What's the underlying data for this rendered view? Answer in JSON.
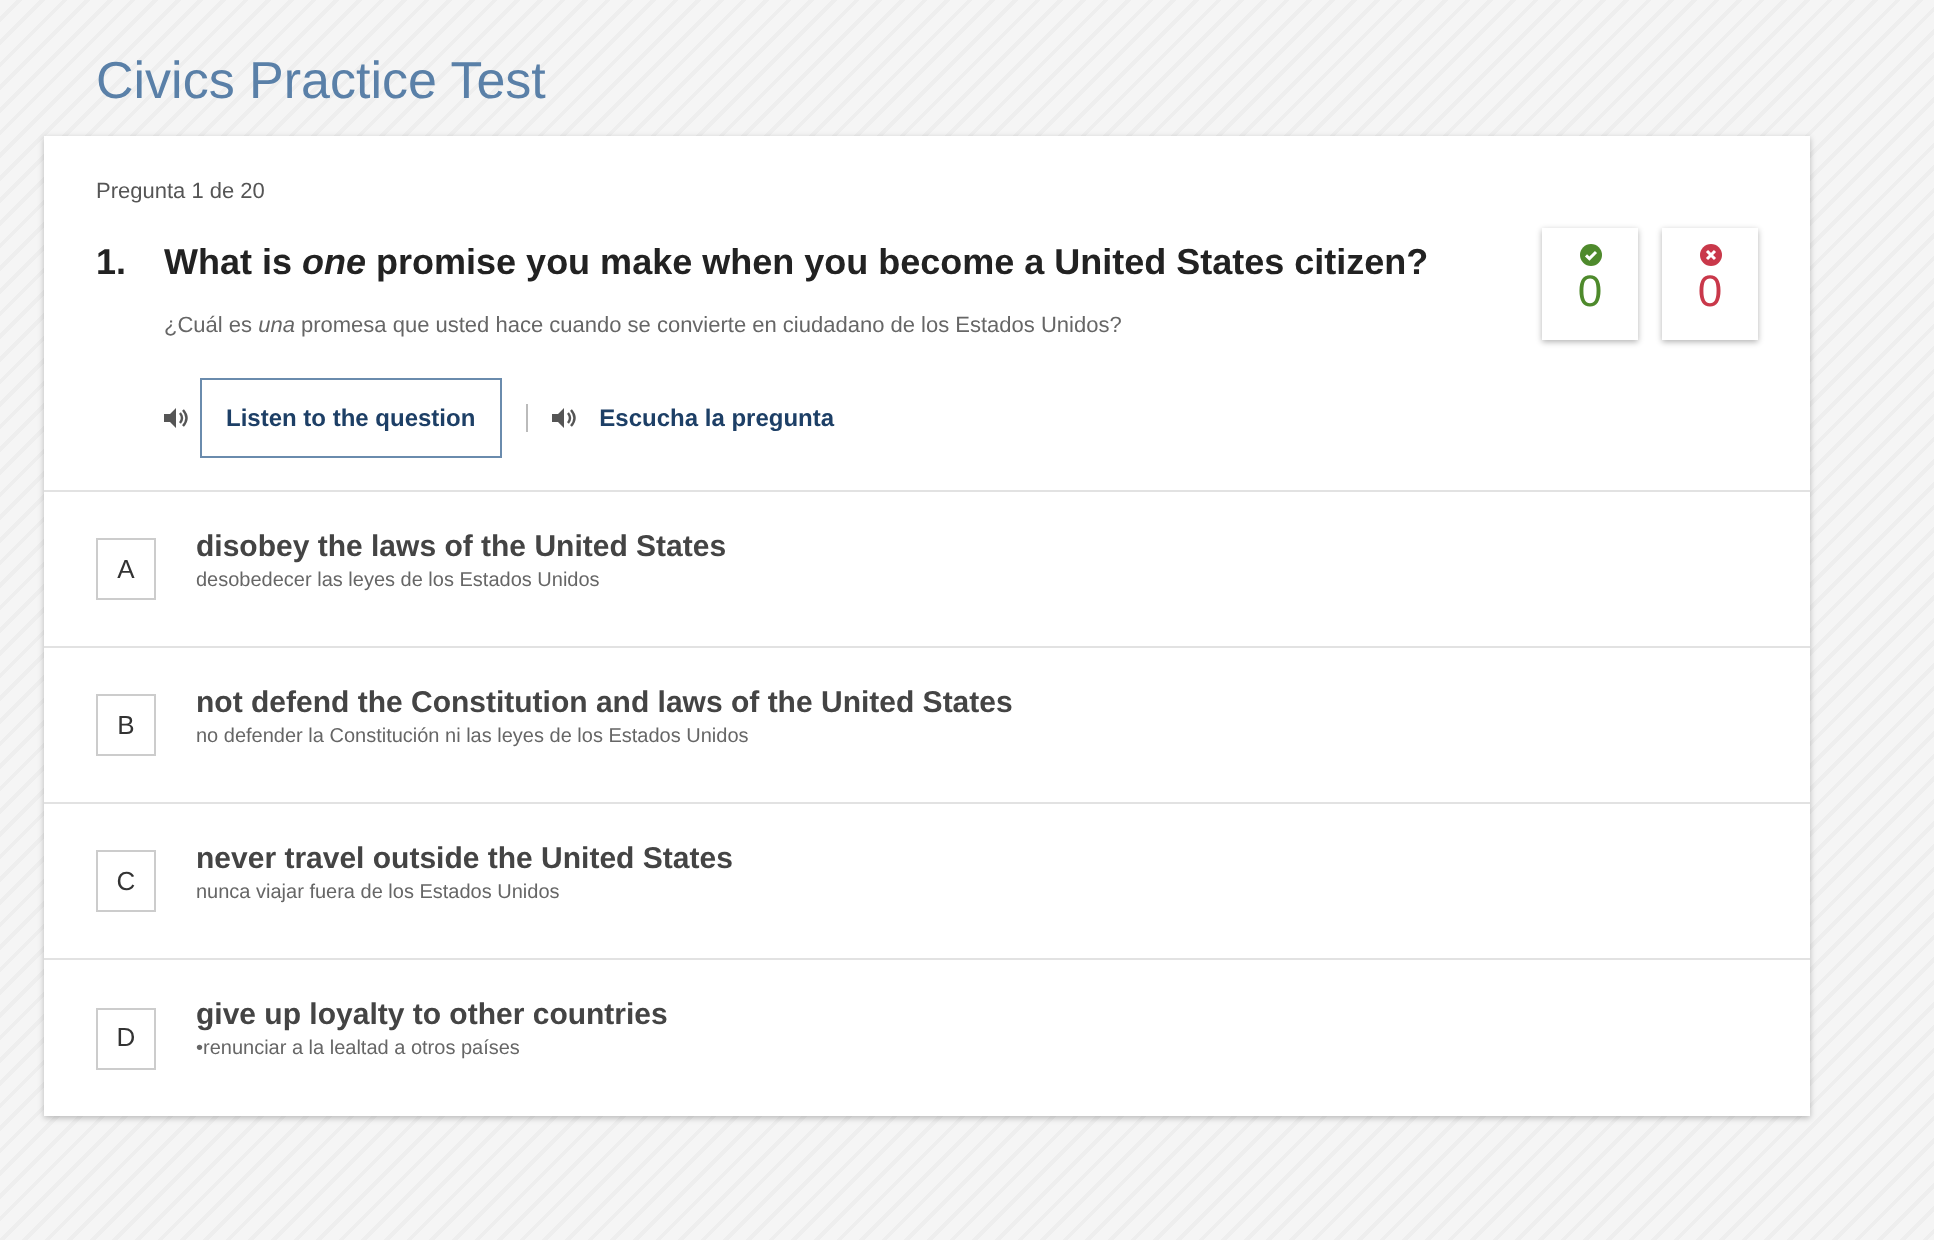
{
  "page_title": "Civics Practice Test",
  "question": {
    "counter": "Pregunta 1 de 20",
    "number": "1.",
    "text": "What is *one* promise you make when you become a United States citizen?",
    "translation": "¿Cuál es *una* promesa que usted hace cuando se convierte en ciudadano de los Estados Unidos?",
    "audio": [
      {
        "label": "Listen to the question",
        "kind": "boxed"
      },
      {
        "label": "Escucha la pregunta",
        "kind": "plain"
      }
    ]
  },
  "scores": [
    {
      "kind": "correct",
      "count": "0"
    },
    {
      "kind": "wrong",
      "count": "0"
    }
  ],
  "choices": [
    {
      "letter": "A",
      "text": "disobey the laws of the United States",
      "translation": "desobedecer las leyes de los Estados Unidos"
    },
    {
      "letter": "B",
      "text": "not defend the Constitution and laws of the United States",
      "translation": "no defender la Constitución ni las leyes de los Estados Unidos"
    },
    {
      "letter": "C",
      "text": "never travel outside the United States",
      "translation": "nunca viajar fuera de los Estados Unidos"
    },
    {
      "letter": "D",
      "text": "give up loyalty to other countries",
      "translation": "•renunciar a la lealtad a otros países"
    }
  ]
}
